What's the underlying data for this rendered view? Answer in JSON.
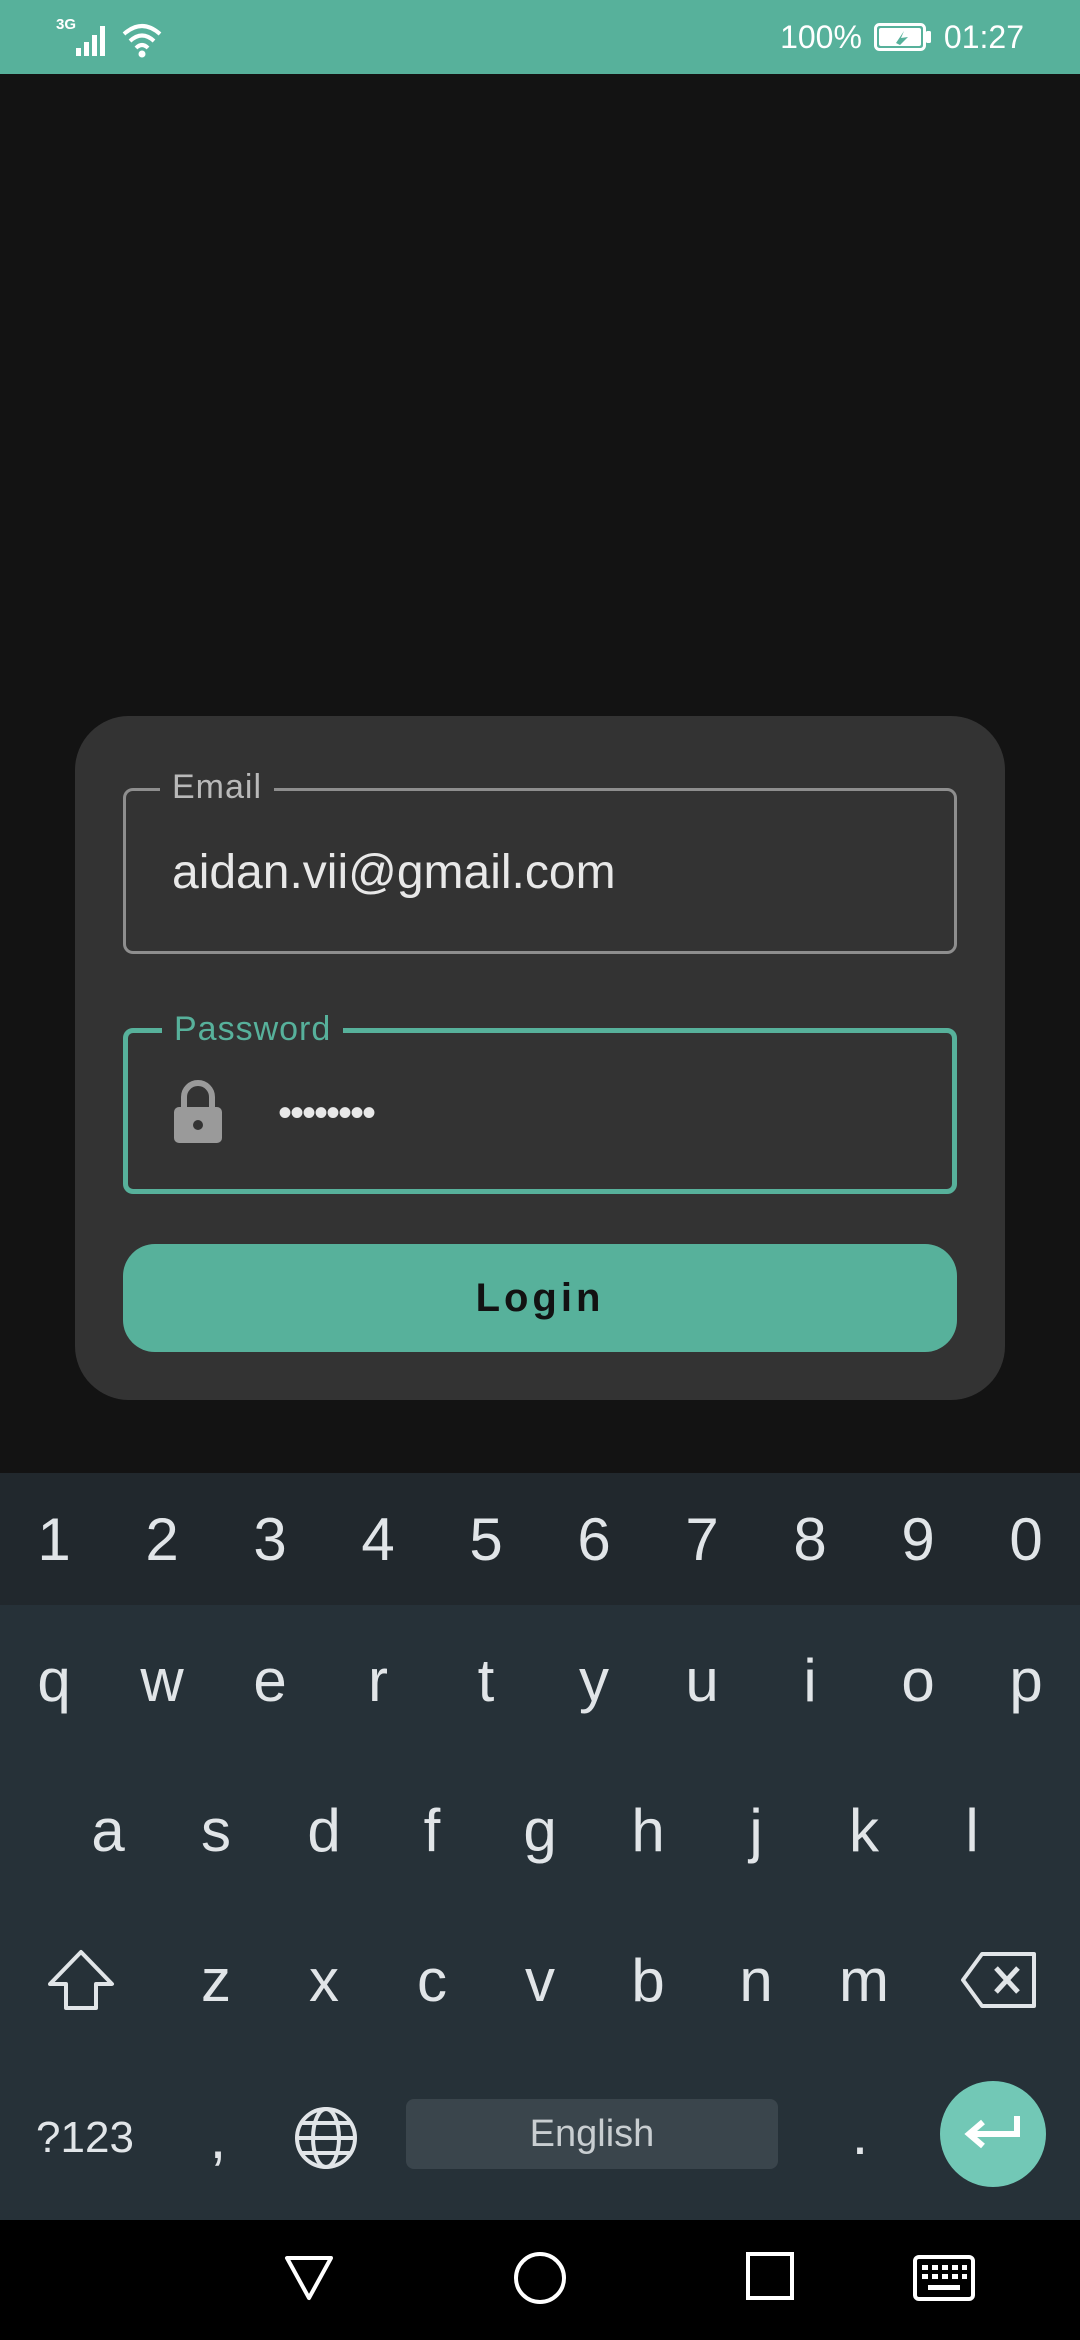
{
  "status_bar": {
    "network_type": "3G",
    "battery_percent": "100%",
    "time": "01:27"
  },
  "login_form": {
    "email_label": "Email",
    "email_value": "aidan.vii@gmail.com",
    "password_label": "Password",
    "password_value": "••••••••",
    "login_button": "Login"
  },
  "keyboard": {
    "number_row": [
      "1",
      "2",
      "3",
      "4",
      "5",
      "6",
      "7",
      "8",
      "9",
      "0"
    ],
    "row1": [
      "q",
      "w",
      "e",
      "r",
      "t",
      "y",
      "u",
      "i",
      "o",
      "p"
    ],
    "row2": [
      "a",
      "s",
      "d",
      "f",
      "g",
      "h",
      "j",
      "k",
      "l"
    ],
    "row3": [
      "z",
      "x",
      "c",
      "v",
      "b",
      "n",
      "m"
    ],
    "symbols_key": "?123",
    "comma_key": ",",
    "period_key": ".",
    "spacebar_label": "English"
  },
  "colors": {
    "accent": "#57b19b",
    "background": "#131313",
    "card": "#333333",
    "keyboard": "#263138"
  },
  "icons": [
    "signal-icon",
    "wifi-icon",
    "battery-icon",
    "lock-icon",
    "shift-icon",
    "backspace-icon",
    "globe-icon",
    "enter-icon",
    "back-icon",
    "home-icon",
    "recents-icon",
    "keyboard-icon"
  ]
}
